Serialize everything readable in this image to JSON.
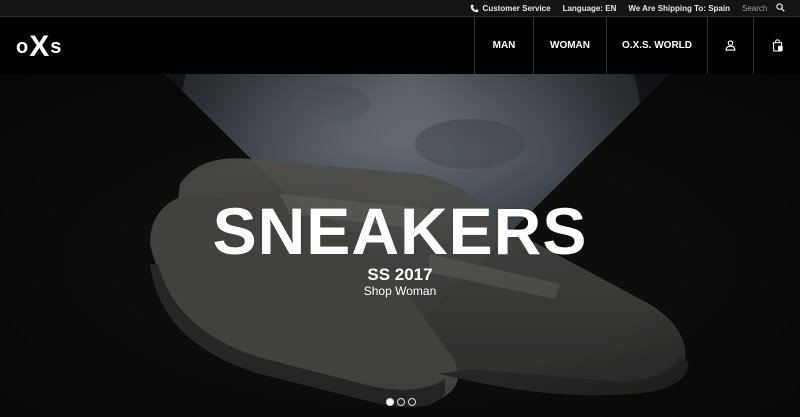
{
  "utility": {
    "customer_service": "Customer Service",
    "language": "Language: EN",
    "shipping": "We Are Shipping To: Spain",
    "search_placeholder": "Search",
    "icons": {
      "phone": "phone-icon",
      "search": "search-icon"
    }
  },
  "header": {
    "logo": {
      "left": "o",
      "middle": "X",
      "right": "s"
    },
    "nav": [
      {
        "label": "MAN"
      },
      {
        "label": "WOMAN"
      },
      {
        "label": "O.X.S. WORLD"
      }
    ],
    "icons": {
      "account": "user-icon",
      "cart": "shopping-bag-icon"
    }
  },
  "hero": {
    "title": "SNEAKERS",
    "subtitle": "SS 2017",
    "cta": "Shop Woman",
    "slides": 3,
    "active_slide": 1
  },
  "colors": {
    "background": "#000000",
    "utility_bar": "#141414",
    "text": "#ffffff"
  }
}
